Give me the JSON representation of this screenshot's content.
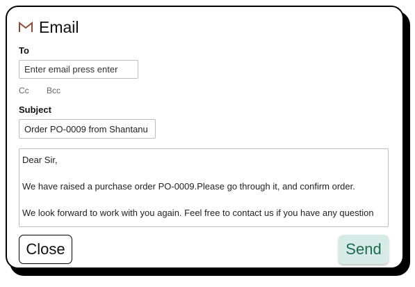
{
  "header": {
    "title": "Email",
    "icon": "gmail-m-icon",
    "icon_color": "#8a4b3a"
  },
  "to": {
    "label": "To",
    "placeholder": "Enter email press enter"
  },
  "cc_label": "Cc",
  "bcc_label": "Bcc",
  "subject": {
    "label": "Subject",
    "value": "Order PO-0009 from Shantanu"
  },
  "body": {
    "lines": [
      "Dear Sir,",
      "",
      "We have raised a purchase order PO-0009.Please go through it, and confirm order.",
      "",
      "We look forward to work with you again. Feel free to contact us if you have any question"
    ]
  },
  "actions": {
    "close_label": "Close",
    "send_label": "Send",
    "send_bg": "#d6ebe6",
    "send_color": "#1e6a4e"
  }
}
